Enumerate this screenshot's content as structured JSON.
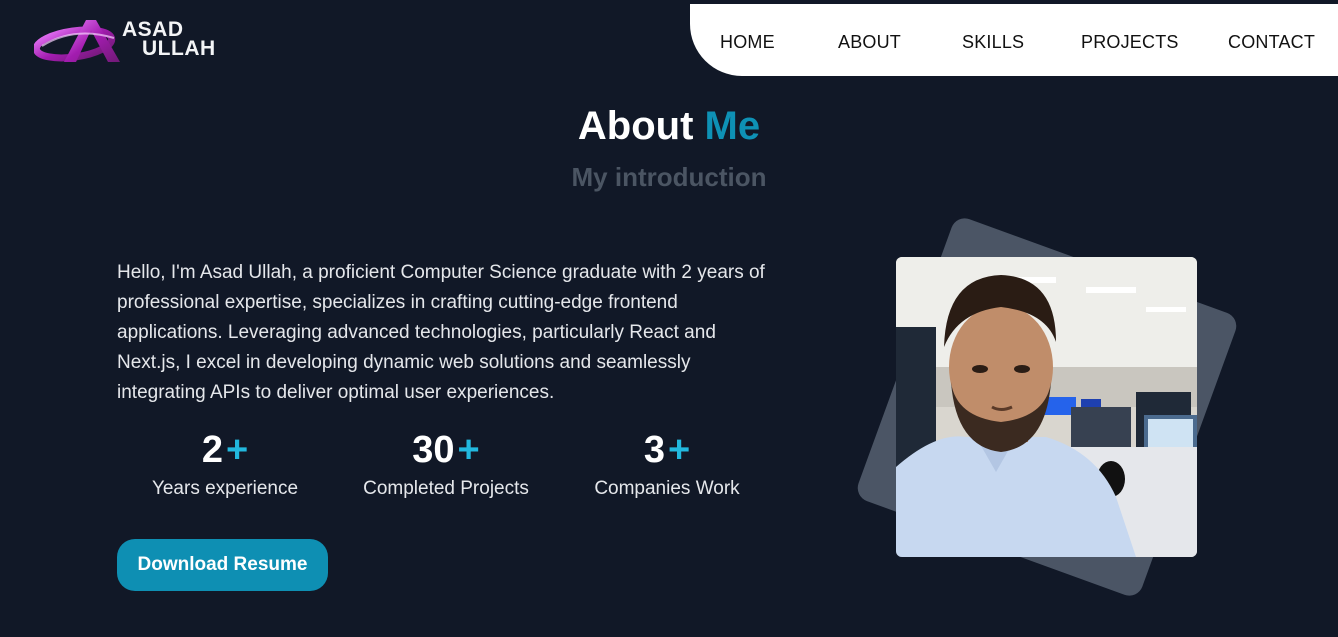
{
  "logo": {
    "line1": "ASAD",
    "line2": "ULLAH",
    "icon": "swoosh-logo-icon",
    "brand_color": "#a21caf"
  },
  "nav": {
    "items": [
      {
        "label": "HOME"
      },
      {
        "label": "ABOUT"
      },
      {
        "label": "SKILLS"
      },
      {
        "label": "PROJECTS"
      },
      {
        "label": "CONTACT"
      }
    ]
  },
  "heading": {
    "title_main": "About",
    "title_accent": "Me",
    "subtitle": "My introduction"
  },
  "intro": "Hello, I'm Asad Ullah, a proficient Computer Science graduate with 2 years of professional expertise, specializes in crafting cutting-edge frontend applications. Leveraging advanced technologies, particularly React and Next.js, I excel in developing dynamic web solutions and seamlessly integrating APIs to deliver optimal user experiences.",
  "stats": [
    {
      "value": "2",
      "suffix": "+",
      "label": "Years experience"
    },
    {
      "value": "30",
      "suffix": "+",
      "label": "Completed Projects"
    },
    {
      "value": "3",
      "suffix": "+",
      "label": "Companies Work"
    }
  ],
  "button": {
    "label": "Download Resume"
  },
  "colors": {
    "background": "#111827",
    "accent": "#0e91b5",
    "plus": "#22b8de",
    "photo_frame": "#4b5565"
  }
}
